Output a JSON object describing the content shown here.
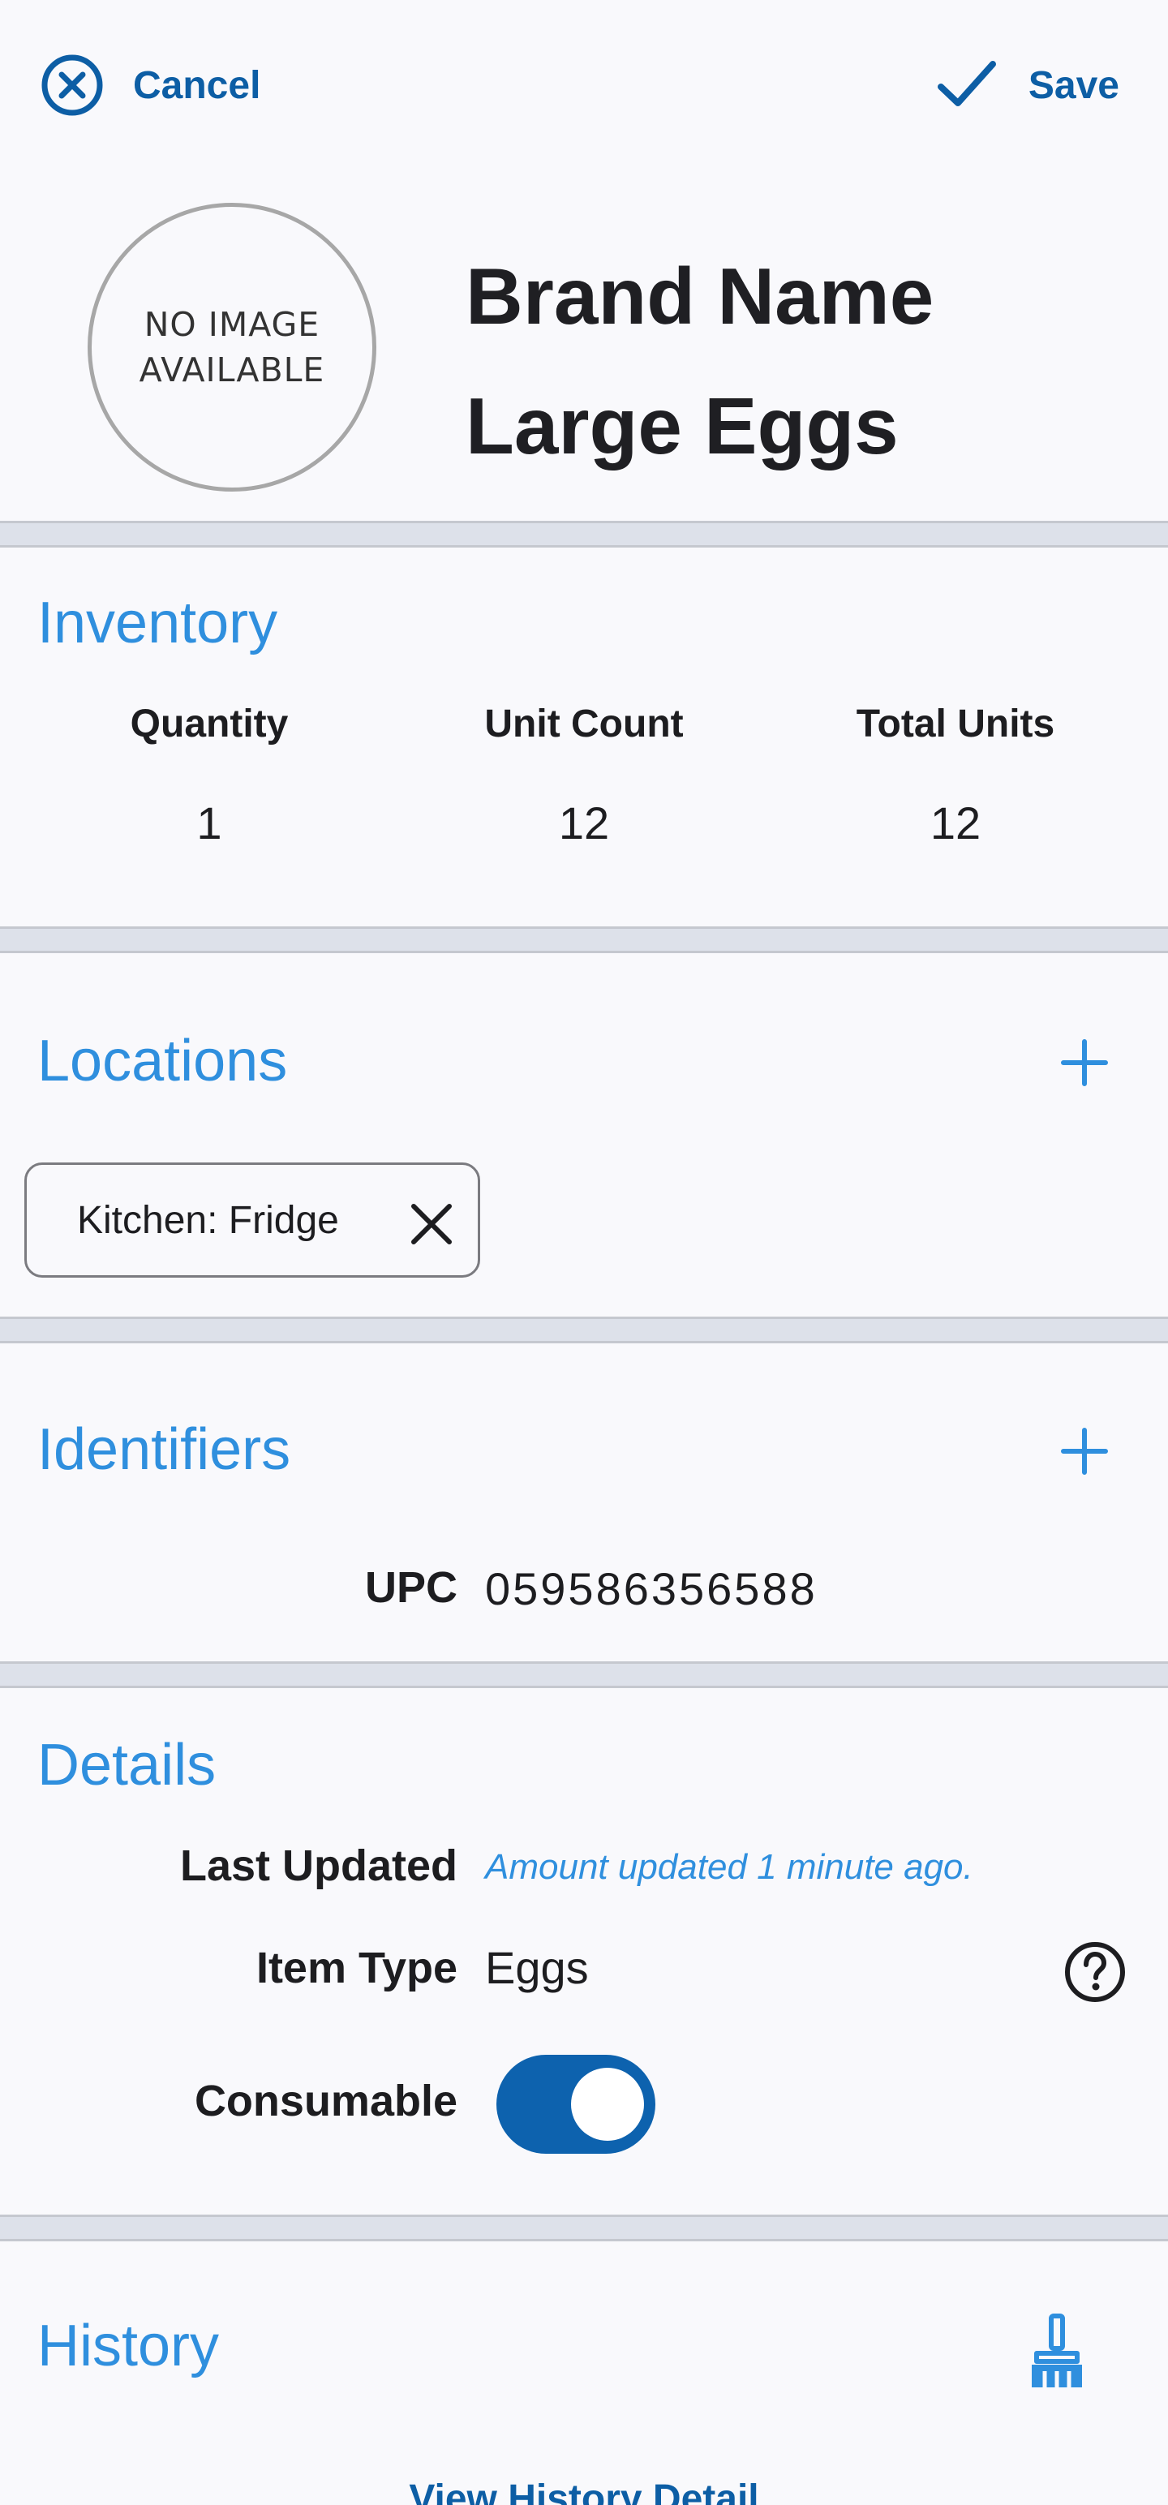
{
  "header": {
    "cancel_label": "Cancel",
    "save_label": "Save",
    "accent_color": "#0d5ea5"
  },
  "product": {
    "image_placeholder_line1": "NO IMAGE",
    "image_placeholder_line2": "AVAILABLE",
    "title_line1": "Brand Name",
    "title_line2": "Large Eggs"
  },
  "inventory": {
    "title": "Inventory",
    "columns": [
      {
        "label": "Quantity",
        "value": "1"
      },
      {
        "label": "Unit Count",
        "value": "12"
      },
      {
        "label": "Total Units",
        "value": "12"
      }
    ]
  },
  "locations": {
    "title": "Locations",
    "add_icon": "plus-icon",
    "chips": [
      {
        "label": "Kitchen: Fridge",
        "remove_icon": "close-icon"
      }
    ]
  },
  "identifiers": {
    "title": "Identifiers",
    "add_icon": "plus-icon",
    "items": [
      {
        "label": "UPC",
        "value": "059586356588"
      }
    ]
  },
  "details": {
    "title": "Details",
    "last_updated_label": "Last Updated",
    "last_updated_value": "Amount updated 1 minute ago.",
    "item_type_label": "Item Type",
    "item_type_value": "Eggs",
    "help_icon": "question-circle-icon",
    "consumable_label": "Consumable",
    "consumable_on": true
  },
  "history": {
    "title": "History",
    "clear_icon": "broom-icon",
    "link_label": "View History Detail"
  },
  "colors": {
    "section_title": "#2f8fde",
    "toggle_on": "#0d62ae",
    "divider": "#dde1ea",
    "card_bg": "#f9f9fc"
  }
}
